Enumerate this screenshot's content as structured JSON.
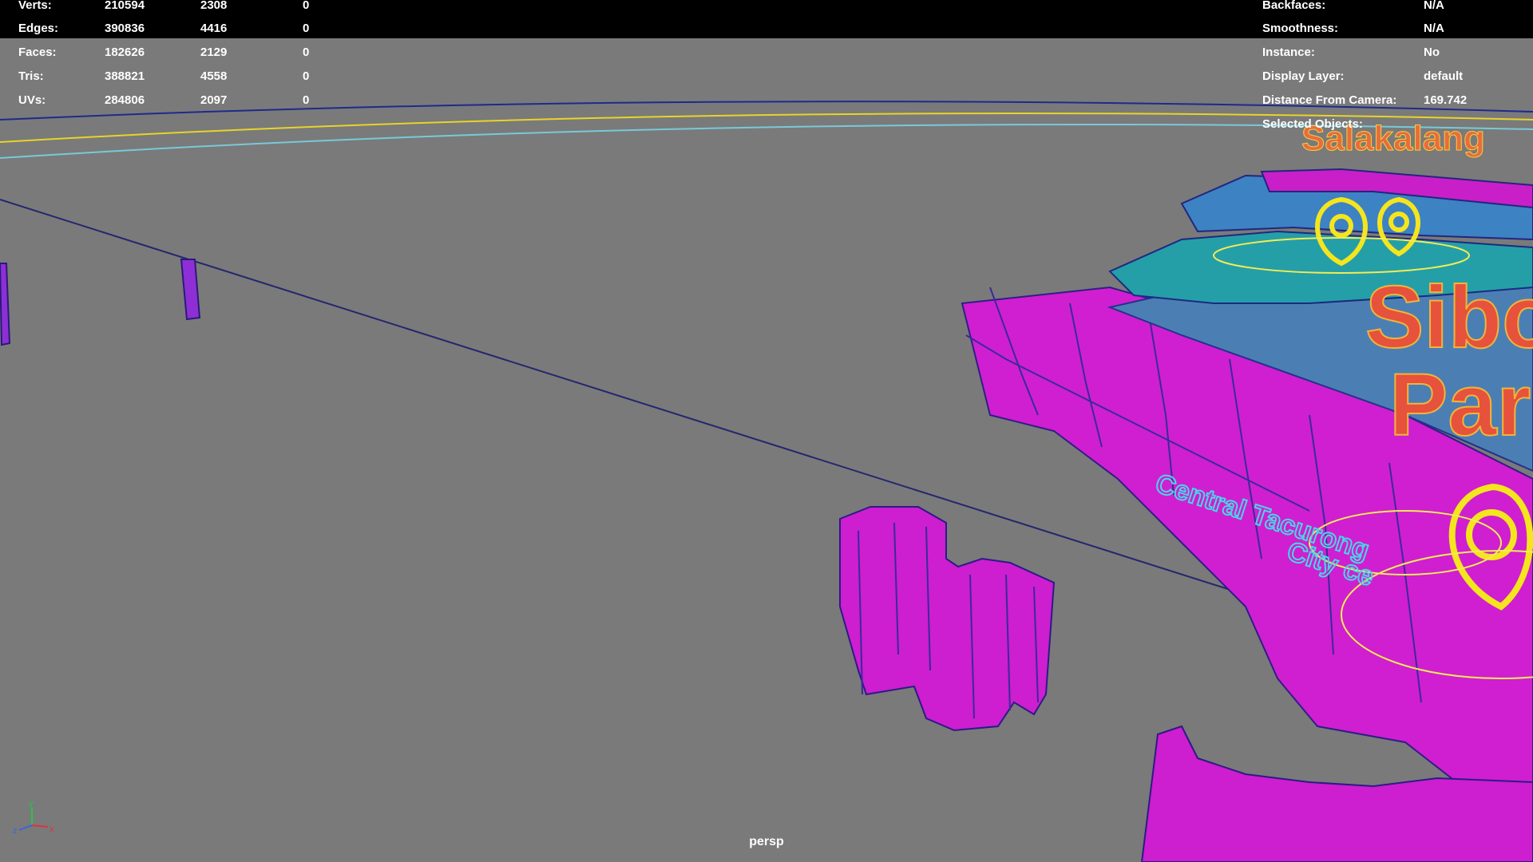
{
  "hud_left": {
    "rows": [
      {
        "label": "Verts:",
        "total": "210594",
        "selected": "2308",
        "extra": "0"
      },
      {
        "label": "Edges:",
        "total": "390836",
        "selected": "4416",
        "extra": "0"
      },
      {
        "label": "Faces:",
        "total": "182626",
        "selected": "2129",
        "extra": "0"
      },
      {
        "label": "Tris:",
        "total": "388821",
        "selected": "4558",
        "extra": "0"
      },
      {
        "label": "UVs:",
        "total": "284806",
        "selected": "2097",
        "extra": "0"
      }
    ]
  },
  "hud_right": {
    "rows": [
      {
        "label": "Backfaces:",
        "value": "N/A"
      },
      {
        "label": "Smoothness:",
        "value": "N/A"
      },
      {
        "label": "Instance:",
        "value": "No"
      },
      {
        "label": "Display Layer:",
        "value": "default"
      },
      {
        "label": "Distance From Camera:",
        "value": "169.742"
      },
      {
        "label": "Selected Objects:",
        "value": ""
      }
    ]
  },
  "scene_text": {
    "town_top": "Salakalang",
    "town_big_1": "Sibo",
    "town_big_2": "Par",
    "place_1": "Central Tacurong",
    "place_2": "City ce"
  },
  "axis": {
    "y": "y",
    "z": "z",
    "x": "x"
  },
  "camera": "persp",
  "colors": {
    "viewport_bg": "#7a7a7a",
    "magenta_mesh": "#d21ad2",
    "teal_mesh": "#27a3a8",
    "blue_mesh": "#4d7fb3",
    "label_orange": "#e35b3a",
    "marker_yellow": "#f4e51f",
    "wire_cyan": "#47d6e6"
  }
}
